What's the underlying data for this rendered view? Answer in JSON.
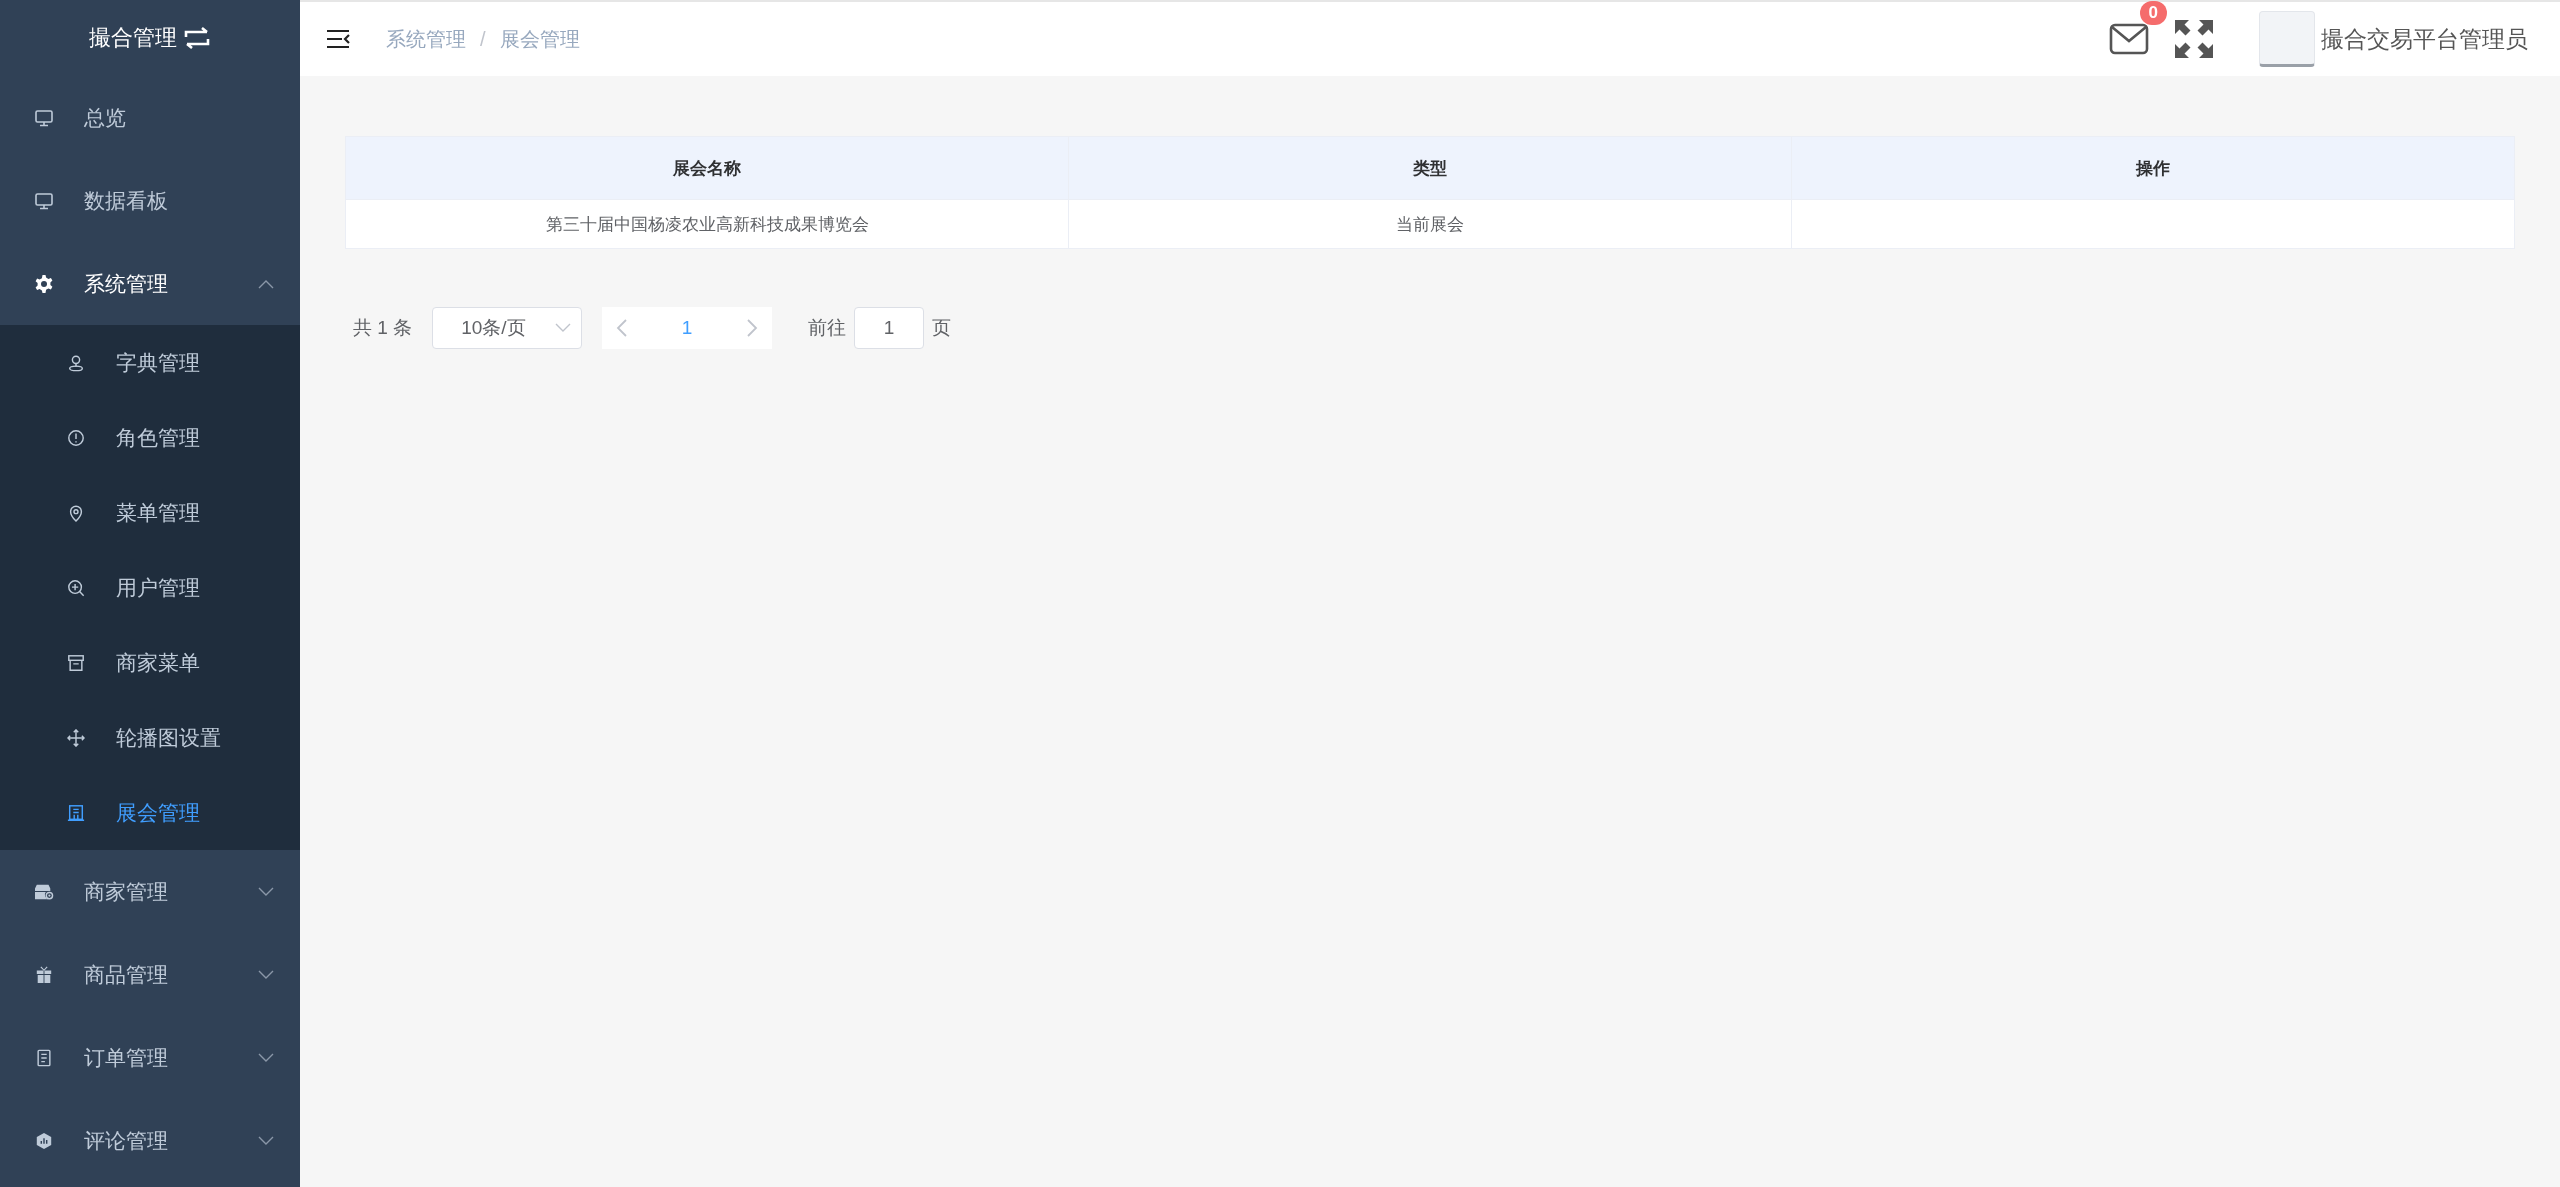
{
  "sidebar": {
    "title": "撮合管理",
    "items": [
      {
        "kind": "link",
        "label": "总览",
        "selected": false
      },
      {
        "kind": "link",
        "label": "数据看板",
        "selected": false
      },
      {
        "kind": "group",
        "label": "系统管理",
        "expanded": true,
        "selected": false,
        "children": [
          {
            "label": "字典管理",
            "selected": false
          },
          {
            "label": "角色管理",
            "selected": false
          },
          {
            "label": "菜单管理",
            "selected": false
          },
          {
            "label": "用户管理",
            "selected": false
          },
          {
            "label": "商家菜单",
            "selected": false
          },
          {
            "label": "轮播图设置",
            "selected": false
          },
          {
            "label": "展会管理",
            "selected": true
          }
        ]
      },
      {
        "kind": "group",
        "label": "商家管理",
        "expanded": false,
        "selected": false
      },
      {
        "kind": "group",
        "label": "商品管理",
        "expanded": false,
        "selected": false
      },
      {
        "kind": "group",
        "label": "订单管理",
        "expanded": false,
        "selected": false
      },
      {
        "kind": "group",
        "label": "评论管理",
        "expanded": false,
        "selected": false
      }
    ]
  },
  "header": {
    "breadcrumb": [
      "系统管理",
      "展会管理"
    ],
    "breadcrumb_separator": "/",
    "message_count": "0",
    "user_name": "撮合交易平台管理员"
  },
  "table": {
    "columns": [
      "展会名称",
      "类型",
      "操作"
    ],
    "rows": [
      {
        "cells": [
          "第三十届中国杨凌农业高新科技成果博览会",
          "当前展会"
        ]
      }
    ]
  },
  "pagination": {
    "total": "共 1 条",
    "page_size": "10条/页",
    "pages": [
      {
        "label": "1",
        "selected": true
      }
    ],
    "goto_label": "前往",
    "goto_value": "1",
    "page_unit": "页"
  }
}
